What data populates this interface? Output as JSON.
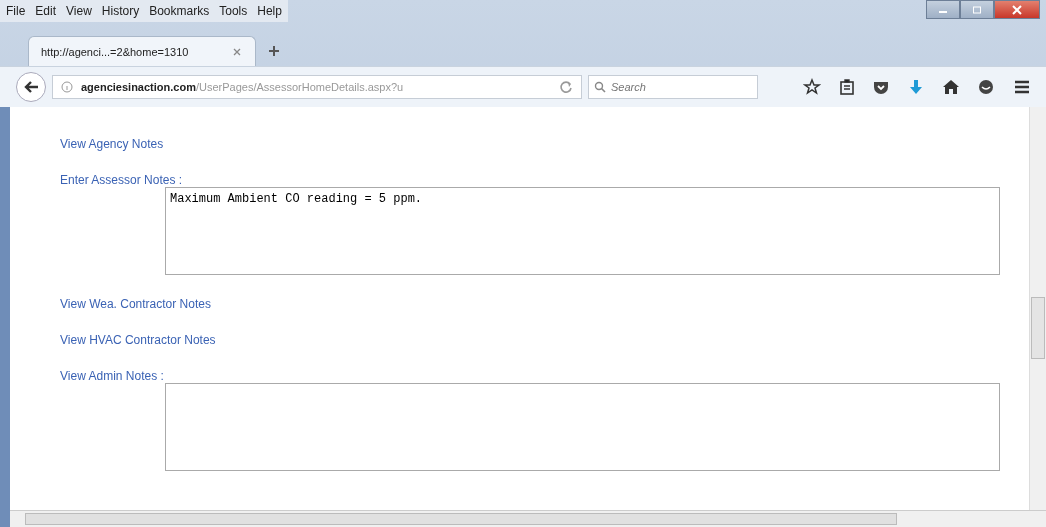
{
  "menu_bar": [
    "File",
    "Edit",
    "View",
    "History",
    "Bookmarks",
    "Tools",
    "Help"
  ],
  "tabs": [
    {
      "label": "http://agenci...=2&home=1310",
      "selected": true
    }
  ],
  "address_bar": {
    "domain": "agenciesinaction.com",
    "path": "/UserPages/AssessorHomeDetails.aspx?u"
  },
  "search": {
    "placeholder": "Search"
  },
  "content": [
    {
      "kind": "link",
      "label": "View Agency Notes"
    },
    {
      "kind": "field",
      "label": "Enter Assessor Notes :",
      "value": "Maximum Ambient CO reading = 5 ppm."
    },
    {
      "kind": "link",
      "label": "View Wea. Contractor Notes"
    },
    {
      "kind": "link",
      "label": "View HVAC Contractor Notes"
    },
    {
      "kind": "field",
      "label": "View Admin Notes :"
    }
  ]
}
